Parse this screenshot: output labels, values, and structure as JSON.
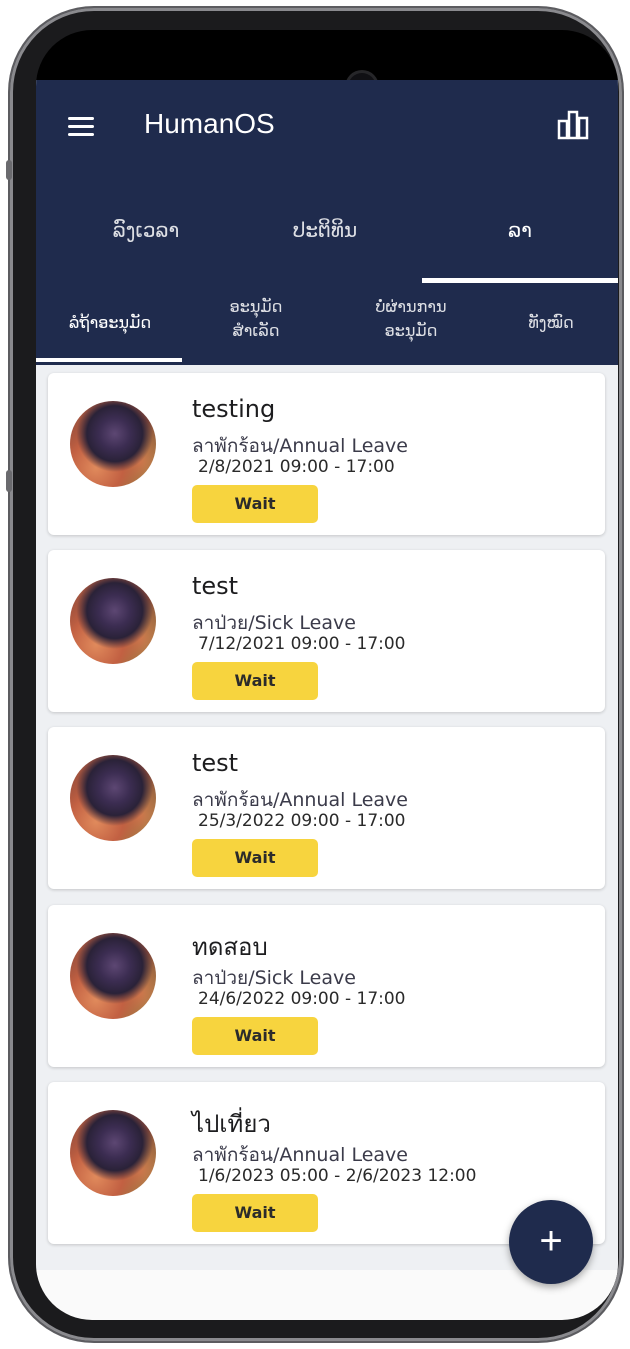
{
  "app": {
    "title": "HumanOS",
    "brand_color": "#1f2b4d",
    "icons": {
      "menu": "hamburger-icon",
      "chart": "bar-chart-icon",
      "add": "plus-icon"
    }
  },
  "main_tabs": [
    {
      "label": "ລົງເວລາ",
      "active": false
    },
    {
      "label": "ປະຕິທິນ",
      "active": false
    },
    {
      "label": "ລາ",
      "active": true
    }
  ],
  "sub_tabs": [
    {
      "line1": "ລໍຖ້າອະນຸມັດ",
      "line2": "",
      "active": true
    },
    {
      "line1": "ອະນຸມັດ",
      "line2": "ສໍາເລັດ",
      "active": false
    },
    {
      "line1": "ບໍ່ຜ່ານການ",
      "line2": "ອະນຸມັດ",
      "active": false
    },
    {
      "line1": "ທັງໝົດ",
      "line2": "",
      "active": false
    }
  ],
  "leave_requests": [
    {
      "title": "testing",
      "type_th": "ลาพักร้อน",
      "type_en": "/Annual Leave",
      "date": "2/8/2021 09:00 - 17:00",
      "status": "Wait"
    },
    {
      "title": "test",
      "type_th": "ลาป่วย",
      "type_en": "/Sick Leave",
      "date": "7/12/2021 09:00 - 17:00",
      "status": "Wait"
    },
    {
      "title": "test",
      "type_th": "ลาพักร้อน",
      "type_en": "/Annual Leave",
      "date": "25/3/2022 09:00 - 17:00",
      "status": "Wait"
    },
    {
      "title": "ทดสอบ",
      "type_th": "ลาป่วย",
      "type_en": "/Sick Leave",
      "date": "24/6/2022 09:00 - 17:00",
      "status": "Wait"
    },
    {
      "title": "ไปเที่ยว",
      "type_th": "ลาพักร้อน",
      "type_en": "/Annual Leave",
      "date": "1/6/2023 05:00 - 2/6/2023 12:00",
      "status": "Wait"
    }
  ],
  "fab": {
    "label": "+"
  },
  "status_color": "#f7d43e"
}
